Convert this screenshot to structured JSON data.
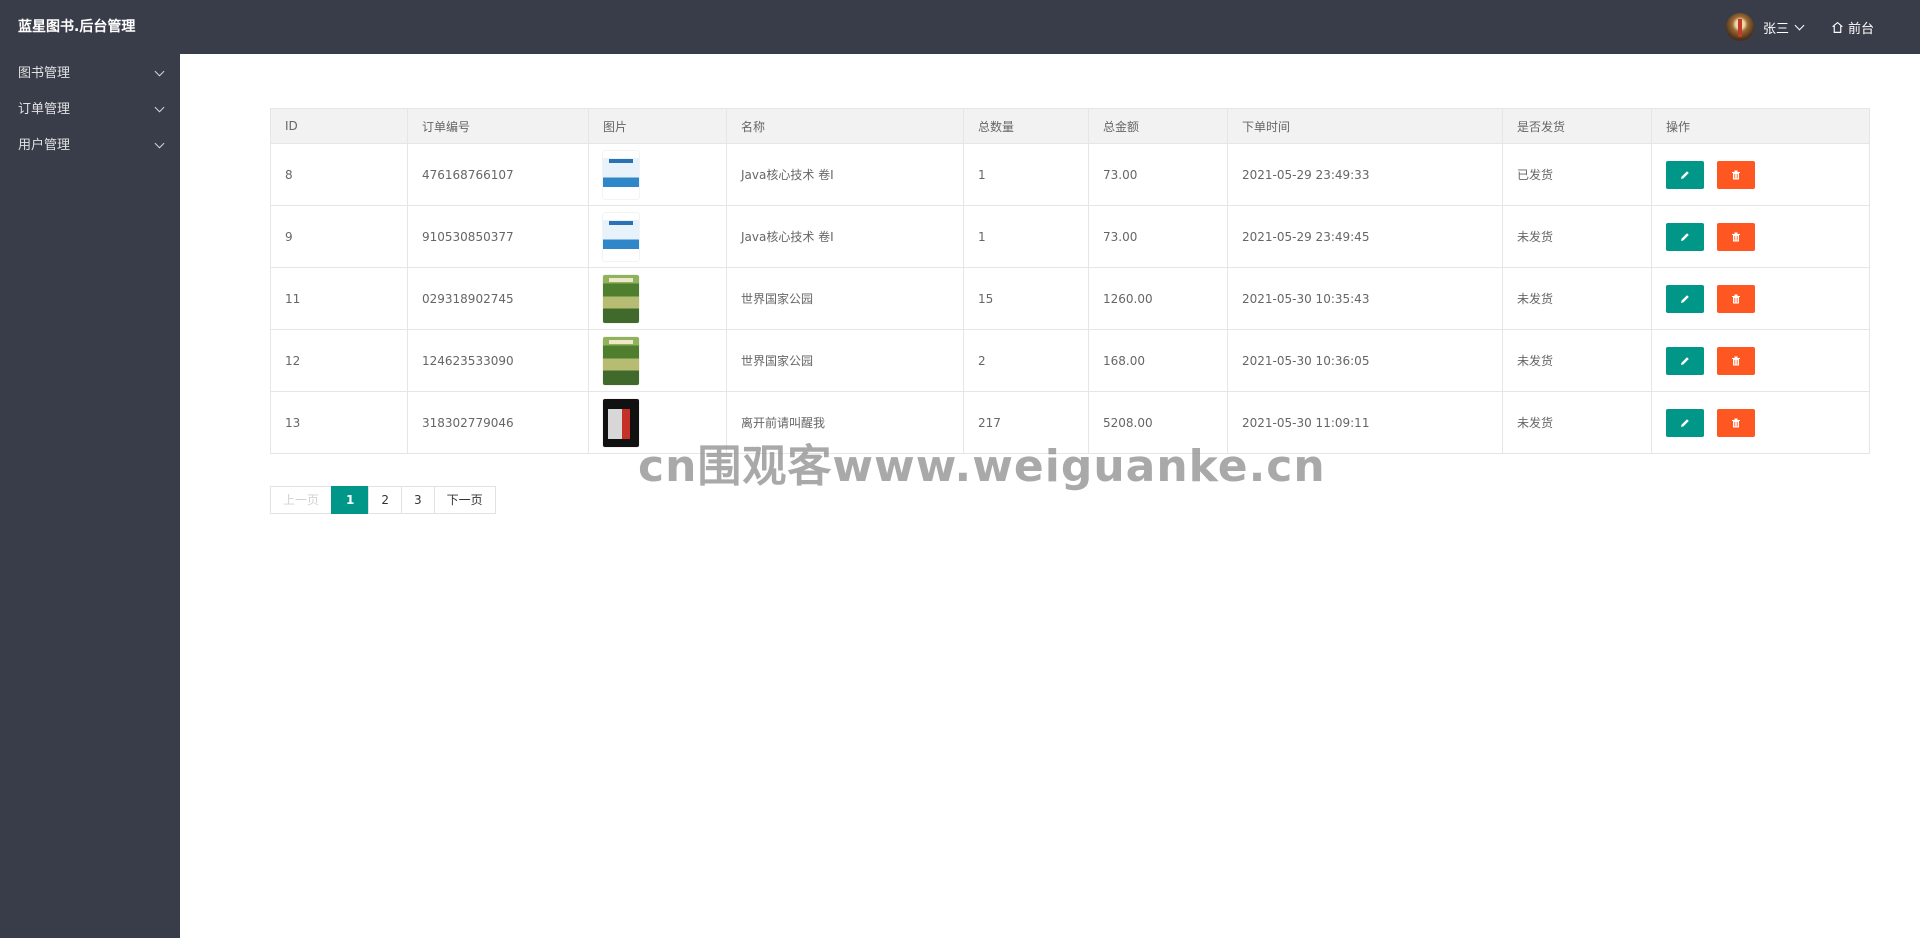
{
  "header": {
    "title": "蓝星图书.后台管理",
    "user_name": "张三",
    "frontend_link": "前台"
  },
  "sidebar": {
    "items": [
      {
        "label": "图书管理"
      },
      {
        "label": "订单管理"
      },
      {
        "label": "用户管理"
      }
    ]
  },
  "table": {
    "columns": [
      "ID",
      "订单编号",
      "图片",
      "名称",
      "总数量",
      "总金额",
      "下单时间",
      "是否发货",
      "操作"
    ],
    "rows": [
      {
        "id": "8",
        "order_no": "476168766107",
        "image": "java-core-book-cover",
        "name": "Java核心技术 卷I",
        "quantity": "1",
        "amount": "73.00",
        "time": "2021-05-29 23:49:33",
        "shipped": "已发货"
      },
      {
        "id": "9",
        "order_no": "910530850377",
        "image": "java-core-book-cover",
        "name": "Java核心技术 卷I",
        "quantity": "1",
        "amount": "73.00",
        "time": "2021-05-29 23:49:45",
        "shipped": "未发货"
      },
      {
        "id": "11",
        "order_no": "029318902745",
        "image": "national-parks-book-cover",
        "name": "世界国家公园",
        "quantity": "15",
        "amount": "1260.00",
        "time": "2021-05-30 10:35:43",
        "shipped": "未发货"
      },
      {
        "id": "12",
        "order_no": "124623533090",
        "image": "national-parks-book-cover",
        "name": "世界国家公园",
        "quantity": "2",
        "amount": "168.00",
        "time": "2021-05-30 10:36:05",
        "shipped": "未发货"
      },
      {
        "id": "13",
        "order_no": "318302779046",
        "image": "dark-novel-book-cover",
        "name": "离开前请叫醒我",
        "quantity": "217",
        "amount": "5208.00",
        "time": "2021-05-30 11:09:11",
        "shipped": "未发货"
      }
    ]
  },
  "pagination": {
    "prev": "上一页",
    "pages": [
      "1",
      "2",
      "3"
    ],
    "current": "1",
    "next": "下一页"
  },
  "watermark": "cn围观客www.weiguanke.cn",
  "colors": {
    "header_bg": "#393d49",
    "sidebar_bg": "#393d49",
    "edit_button": "#009688",
    "delete_button": "#ff5722",
    "current_page": "#009688"
  }
}
